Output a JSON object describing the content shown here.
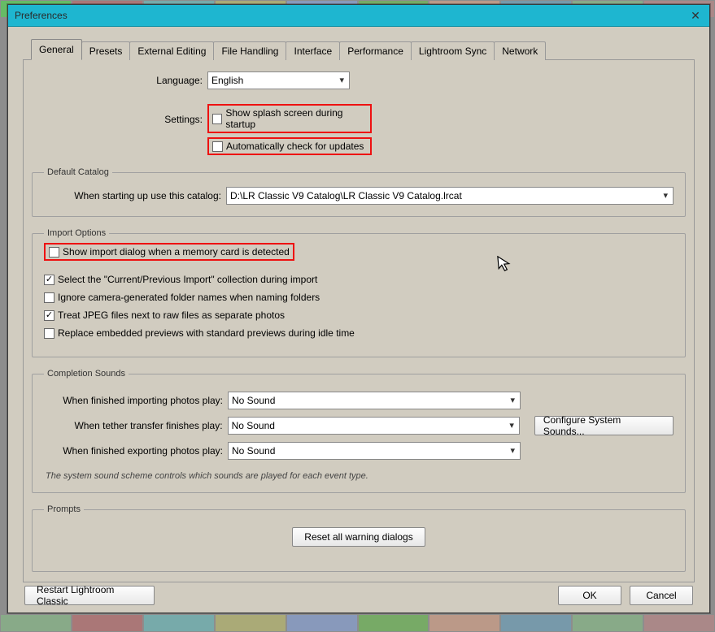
{
  "window": {
    "title": "Preferences"
  },
  "tabs": [
    {
      "label": "General",
      "active": true
    },
    {
      "label": "Presets"
    },
    {
      "label": "External Editing"
    },
    {
      "label": "File Handling"
    },
    {
      "label": "Interface"
    },
    {
      "label": "Performance"
    },
    {
      "label": "Lightroom Sync"
    },
    {
      "label": "Network"
    }
  ],
  "general": {
    "language_label": "Language:",
    "language_value": "English",
    "settings_label": "Settings:",
    "splash_label": "Show splash screen during startup",
    "updates_label": "Automatically check for updates"
  },
  "default_catalog": {
    "legend": "Default Catalog",
    "label": "When starting up use this catalog:",
    "value": "D:\\LR Classic V9 Catalog\\LR Classic V9 Catalog.lrcat"
  },
  "import_options": {
    "legend": "Import Options",
    "opt1": "Show import dialog when a memory card is detected",
    "opt2": "Select the \"Current/Previous Import\" collection during import",
    "opt3": "Ignore camera-generated folder names when naming folders",
    "opt4": "Treat JPEG files next to raw files as separate photos",
    "opt5": "Replace embedded previews with standard previews during idle time"
  },
  "sounds": {
    "legend": "Completion Sounds",
    "row1_label": "When finished importing photos play:",
    "row2_label": "When tether transfer finishes play:",
    "row3_label": "When finished exporting photos play:",
    "value": "No Sound",
    "config_btn": "Configure System Sounds...",
    "note": "The system sound scheme controls which sounds are played for each event type."
  },
  "prompts": {
    "legend": "Prompts",
    "reset_btn": "Reset all warning dialogs"
  },
  "footer": {
    "restart": "Restart Lightroom Classic",
    "ok": "OK",
    "cancel": "Cancel"
  }
}
